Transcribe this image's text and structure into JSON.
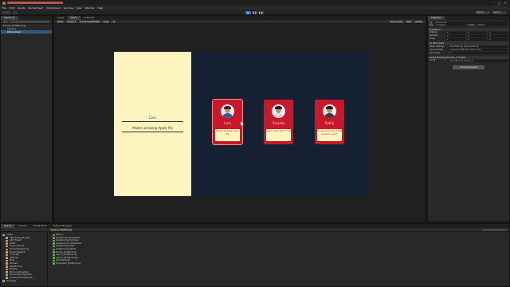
{
  "window": {
    "title": "",
    "controls": [
      "–",
      "□",
      "×"
    ]
  },
  "menu": [
    "File",
    "Edit",
    "Assets",
    "GameObject",
    "Component",
    "Services",
    "Jobs",
    "Window",
    "Help"
  ],
  "toolbar": {
    "play_icons": [
      "▶",
      "❚❚",
      "▶❚"
    ],
    "right": [
      "Layers",
      "Layout"
    ]
  },
  "hierarchy": {
    "tabs": [
      "Hierarchy"
    ],
    "items": [
      {
        "label": "Events_DataBinding",
        "indent": 1,
        "selected": false
      },
      {
        "label": "Camera",
        "indent": 2,
        "selected": false
      },
      {
        "label": "UIDocument",
        "indent": 2,
        "selected": true
      }
    ]
  },
  "view": {
    "tabs": [
      "Scene",
      "Game",
      "UI Builder"
    ],
    "active_tab": "Game",
    "subbar": [
      "Game",
      "Display 1",
      "Full HD (1920x1080)",
      "Scale",
      "1x",
      "Play Focused",
      "Stats",
      "Gizmos"
    ]
  },
  "game": {
    "left_pane": {
      "name": "Lars",
      "subtitle": "Makes amazing Apple Pie"
    },
    "cards": [
      {
        "name": "Lars",
        "description": "Makes amazing Apple Pie",
        "shirt_color": "#2e5aa8",
        "hair_color": "#3a2a22"
      },
      {
        "name": "Ricardo",
        "description": "Never shuts the f***ing",
        "shirt_color": "#d9d9d9",
        "hair_color": "#1f1f1f"
      },
      {
        "name": "Robin",
        "description": "Do you wanna be a YOE Guidance user?",
        "shirt_color": "#3f3f3f",
        "hair_color": "#2a1e18"
      }
    ],
    "colors": {
      "left_bg": "#fef4bf",
      "right_bg": "#152032",
      "card_bg": "#c9172b"
    }
  },
  "inspector": {
    "tabs": [
      "Inspector"
    ],
    "object_name": "UIDocument",
    "tag_label": "Tag",
    "tag_value": "Untagged",
    "layer_label": "Layer",
    "layer_value": "Default",
    "transform": {
      "header": "Transform",
      "rows": [
        {
          "label": "Position",
          "x": "0",
          "y": "0",
          "z": "0"
        },
        {
          "label": "Rotation",
          "x": "0",
          "y": "0",
          "z": "0"
        },
        {
          "label": "Scale",
          "x": "1",
          "y": "1",
          "z": "1"
        }
      ]
    },
    "ui_document": {
      "header": "UI Document",
      "rows": [
        {
          "label": "Panel Settings",
          "value": "PanelSettings (Panel Settings)"
        },
        {
          "label": "Source Asset",
          "value": "Layout_DataBinding (Visual Tree)"
        },
        {
          "label": "Sort Order",
          "value": "0"
        }
      ]
    },
    "script": {
      "header": "Event Binding_Tutorial_2 (Script)",
      "rows": [
        {
          "label": "Script",
          "value": "EventBinding_Tutorial_2"
        }
      ]
    },
    "add_component": "Add Component"
  },
  "project": {
    "tabs": [
      "Project",
      "Console",
      "Profile Write",
      "Tutorial Manager"
    ],
    "tree": [
      "Assets",
      "AEC_Prepared_Data",
      "AEC_Project",
      "Editor",
      "Event_Tutorial",
      "EventsDispatching",
      "EventsDispatch",
      "UI Toolkit",
      "Settings",
      "Mats",
      "Shaders",
      "DataBinding",
      "Binding",
      "Binding_Properties",
      "Events_BindingFolder",
      "Events_BindingsFolder",
      "Packages"
    ],
    "breadcrumb": "Assets > DataBinding",
    "files": [
      "Data.cs",
      "Databinding_Properties",
      "DataBinding_Example",
      "Databinding_Initialization",
      "DataBinding_Start",
      "DataBinding_Start2",
      "Events_DataBinding",
      "Layout_DataBinding",
      "Layout_DataBinding2",
      "PanelSettings",
      "Stylesheet_DataBinding"
    ]
  }
}
